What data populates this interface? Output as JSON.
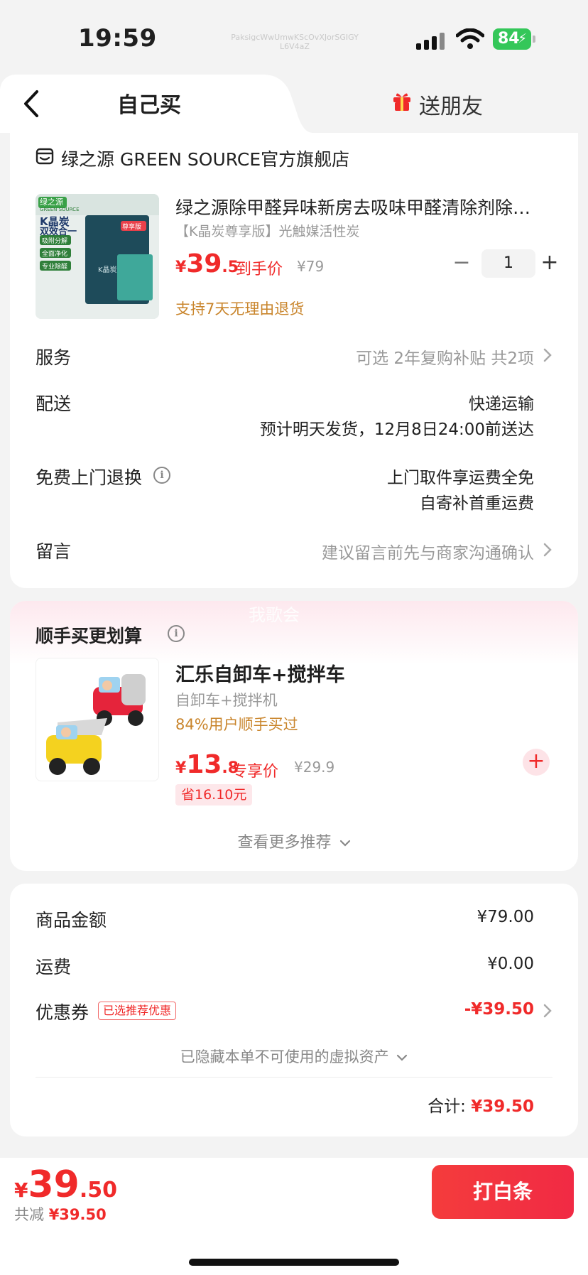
{
  "status_bar": {
    "time": "19:59",
    "watermark": "PaksigcWwUmwKScOvXJorSGIGY L6V4aZ",
    "battery": "84"
  },
  "tabs": {
    "self_buy": "自己买",
    "send_friend": "送朋友"
  },
  "store": {
    "name": "绿之源 GREEN SOURCE官方旗舰店"
  },
  "product": {
    "title": "绿之源除甲醛异味新房去吸味甲醛清除剂除…",
    "sku": "【K晶炭尊享版】光触媒活性炭",
    "price_yen": "¥",
    "price_int": "39",
    "price_dec": ".5",
    "price_tag": "到手价",
    "original_price": "¥79",
    "quantity": "1",
    "qty_minus": "−",
    "qty_plus": "+",
    "return_policy": "支持7天无理由退货",
    "image_texts": {
      "brand": "绿之源",
      "brand_en": "GREEN SOURCE",
      "headline1": "K晶炭",
      "headline2": "双效合一",
      "tag1": "吸附分解",
      "tag2": "全面净化",
      "tag3": "专业除醛",
      "badge": "尊享版",
      "box_label": "K晶炭"
    }
  },
  "order_rows": {
    "service_label": "服务",
    "service_value": "可选 2年复购补贴 共2项",
    "delivery_label": "配送",
    "delivery_method": "快递运输",
    "delivery_eta": "预计明天发货，12月8日24:00前送达",
    "free_return_label": "免费上门退换",
    "free_return_line1": "上门取件享运费全免",
    "free_return_line2": "自寄补首重运费",
    "message_label": "留言",
    "message_placeholder": "建议留言前先与商家沟通确认"
  },
  "bundle": {
    "title": "顺手买更划算",
    "watermark": "我歌会",
    "item_name": "汇乐自卸车+搅拌车",
    "item_sub": "自卸车+搅拌机",
    "buyers": "84%用户顺手买过",
    "price_yen": "¥",
    "price_int": "13",
    "price_dec": ".8",
    "price_tag": "专享价",
    "original_price": "¥29.9",
    "savings": "省16.10元",
    "add": "+",
    "more": "查看更多推荐"
  },
  "summary": {
    "goods_label": "商品金额",
    "goods_value": "¥79.00",
    "shipping_label": "运费",
    "shipping_value": "¥0.00",
    "coupon_label": "优惠券",
    "coupon_badge": "已选推荐优惠",
    "coupon_value": "-¥39.50",
    "hidden_assets": "已隐藏本单不可使用的虚拟资产",
    "total_label": "合计:",
    "total_value": "¥39.50"
  },
  "bottom_bar": {
    "price_yen": "¥",
    "price_int": "39",
    "price_dec": ".50",
    "discount_label": "共减",
    "discount_value": "¥39.50",
    "pay_button": "打白条"
  },
  "colors": {
    "accent_red": "#f02a2a",
    "orange_note": "#c9852c",
    "battery_green": "#34c759"
  }
}
